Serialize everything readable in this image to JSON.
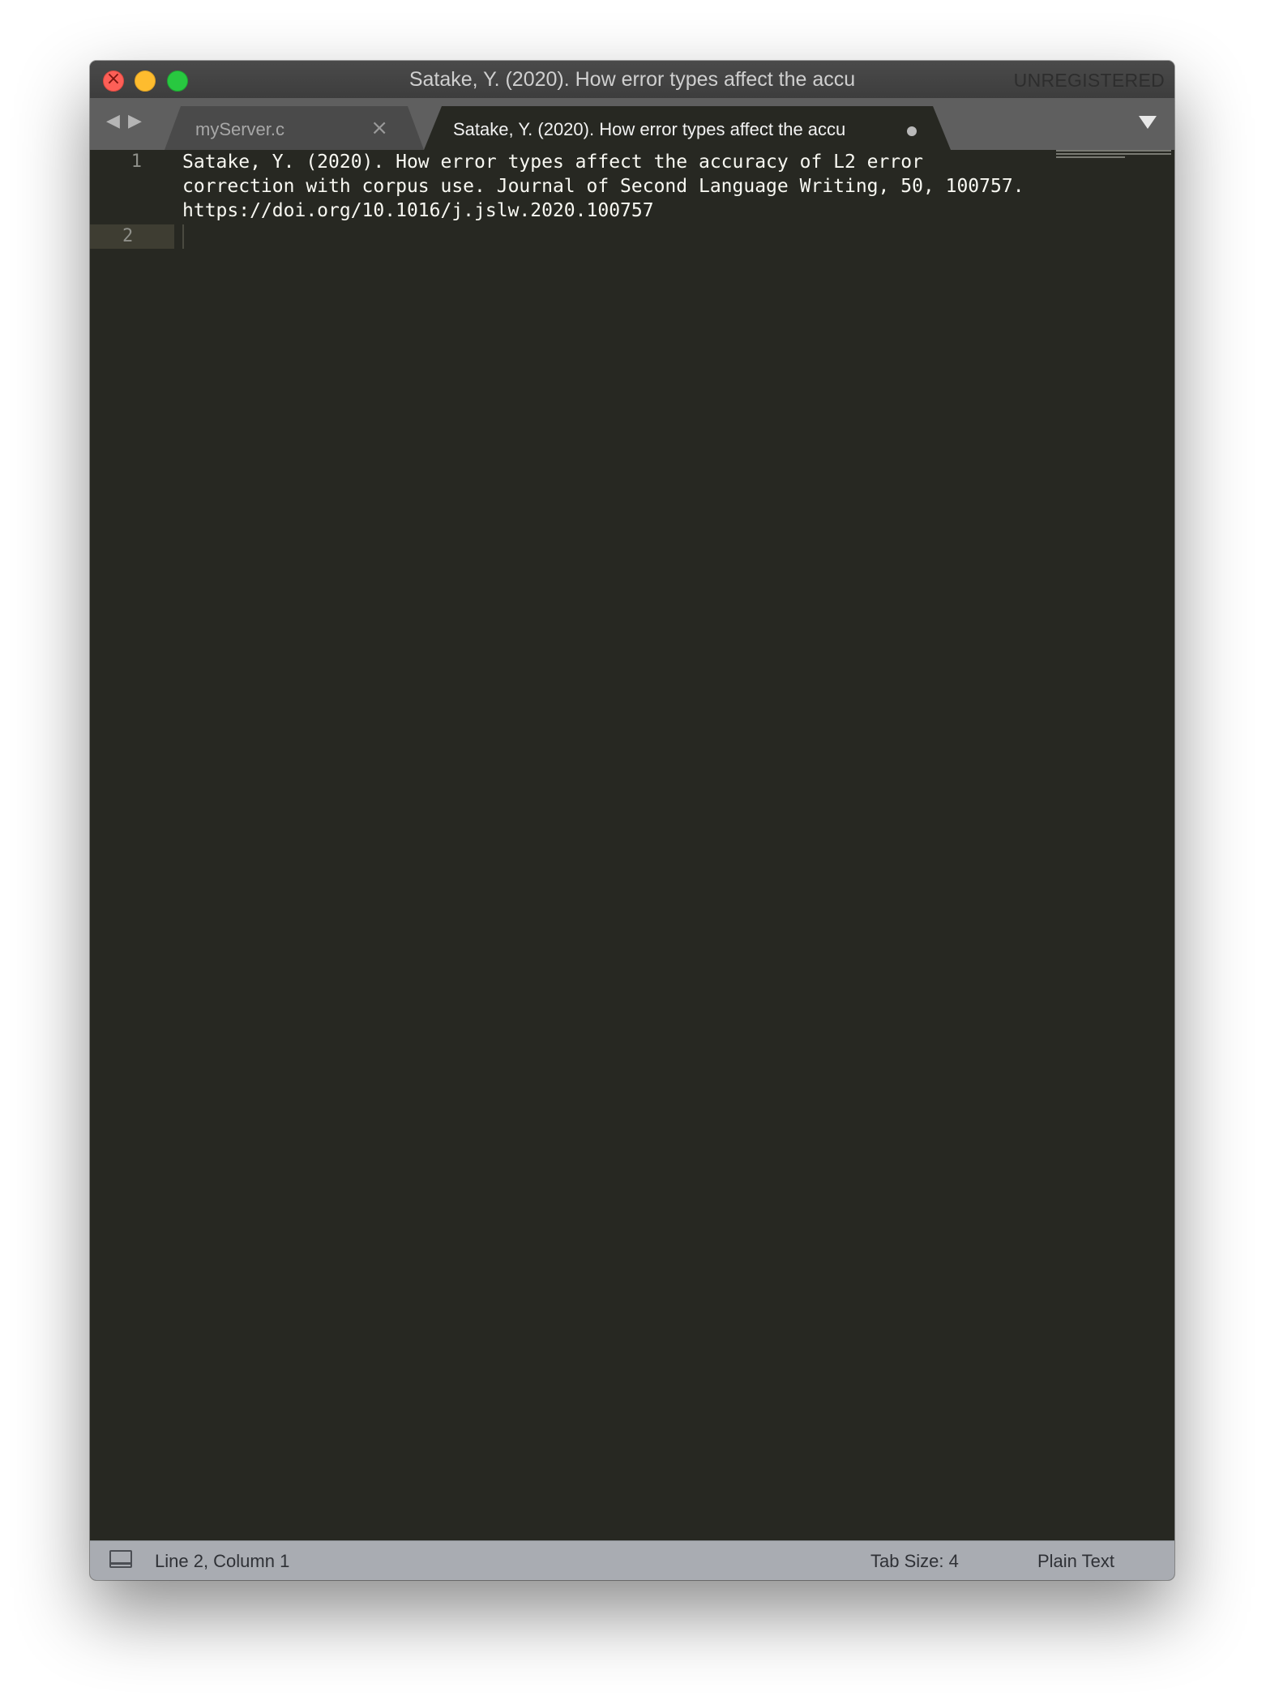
{
  "window": {
    "title": "Satake, Y. (2020). How error types affect the accu",
    "license_label": "UNREGISTERED"
  },
  "tabs": [
    {
      "label": "myServer.c",
      "active": false,
      "close_glyph": "×"
    },
    {
      "label": "Satake, Y. (2020). How error types affect the accu",
      "active": true,
      "dirty": true
    }
  ],
  "nav": {
    "back_glyph": "◀",
    "forward_glyph": "▶"
  },
  "editor": {
    "line_numbers": [
      "1",
      "2"
    ],
    "lines": [
      "Satake, Y. (2020). How error types affect the accuracy of L2 error",
      "correction with corpus use. Journal of Second Language Writing, 50, 100757.",
      "https://doi.org/10.1016/j.jslw.2020.100757",
      ""
    ]
  },
  "statusbar": {
    "position": "Line 2, Column 1",
    "tab_size": "Tab Size: 4",
    "syntax": "Plain Text"
  },
  "colors": {
    "editor_bg": "#272822",
    "text": "#f8f8f2",
    "gutter_text": "#8f908a",
    "statusbar_bg": "#a9acb2"
  }
}
